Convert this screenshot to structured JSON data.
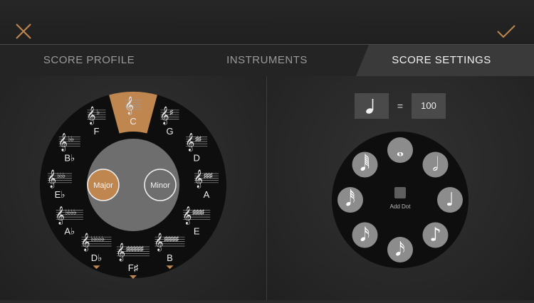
{
  "colors": {
    "accent": "#c08650",
    "ring": "#0e0e0e",
    "hub": "#6e6e6e",
    "noteBtn": "#8c8c8c"
  },
  "tabs": [
    {
      "label": "SCORE PROFILE"
    },
    {
      "label": "INSTRUMENTS"
    },
    {
      "label": "SCORE SETTINGS"
    }
  ],
  "key_wheel": {
    "keys": [
      {
        "name": "C",
        "accidentals": ""
      },
      {
        "name": "G",
        "accidentals": "♯"
      },
      {
        "name": "D",
        "accidentals": "♯♯"
      },
      {
        "name": "A",
        "accidentals": "♯♯♯"
      },
      {
        "name": "E",
        "accidentals": "♯♯♯♯"
      },
      {
        "name": "B",
        "accidentals": "♯♯♯♯♯"
      },
      {
        "name": "F♯",
        "accidentals": "♯♯♯♯♯♯"
      },
      {
        "name": "D♭",
        "accidentals": "♭♭♭♭♭"
      },
      {
        "name": "A♭",
        "accidentals": "♭♭♭♭"
      },
      {
        "name": "E♭",
        "accidentals": "♭♭♭"
      },
      {
        "name": "B♭",
        "accidentals": "♭♭"
      },
      {
        "name": "F",
        "accidentals": "♭"
      }
    ],
    "selected_key": "C",
    "modes": {
      "major": "Major",
      "minor": "Minor",
      "selected": "major"
    }
  },
  "tempo": {
    "beat_note": "quarter-note-icon",
    "equals": "=",
    "bpm": "100"
  },
  "note_wheel": {
    "notes": [
      {
        "icon": "whole-note-icon",
        "glyph": "𝅝"
      },
      {
        "icon": "half-note-icon",
        "glyph": "𝅗𝅥"
      },
      {
        "icon": "quarter-note-icon",
        "glyph": "♩"
      },
      {
        "icon": "eighth-note-icon",
        "glyph": "♪"
      },
      {
        "icon": "sixteenth-note-icon",
        "glyph": "𝅘𝅥𝅯"
      },
      {
        "icon": "sixteenth-note-icon",
        "glyph": "𝅘𝅥𝅯"
      },
      {
        "icon": "thirty-second-note-icon",
        "glyph": "𝅘𝅥𝅰"
      },
      {
        "icon": "sixty-fourth-note-icon",
        "glyph": "𝅘𝅥𝅱"
      }
    ],
    "add_dot_label": "Add Dot"
  }
}
